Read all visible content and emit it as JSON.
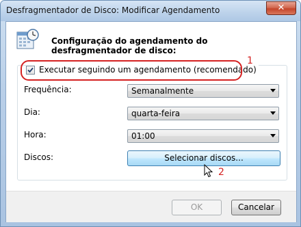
{
  "window": {
    "title": "Desfragmentador de Disco: Modificar Agendamento",
    "close_label": "✕"
  },
  "header": {
    "icon": "calendar-icon",
    "text": "Configuração do agendamento do desfragmentador de disco:"
  },
  "schedule": {
    "checkbox_label": "Executar seguindo um agendamento (recomendado)",
    "checked": true
  },
  "fields": {
    "frequency": {
      "label": "Frequência:",
      "value": "Semanalmente"
    },
    "day": {
      "label": "Dia:",
      "value": "quarta-feira"
    },
    "time": {
      "label": "Hora:",
      "value": "01:00"
    },
    "disks": {
      "label": "Discos:",
      "button_label": "Selecionar discos..."
    }
  },
  "annotations": {
    "marker1": "1",
    "marker2": "2",
    "color": "#d42020"
  },
  "footer": {
    "ok_label": "OK",
    "cancel_label": "Cancelar"
  }
}
